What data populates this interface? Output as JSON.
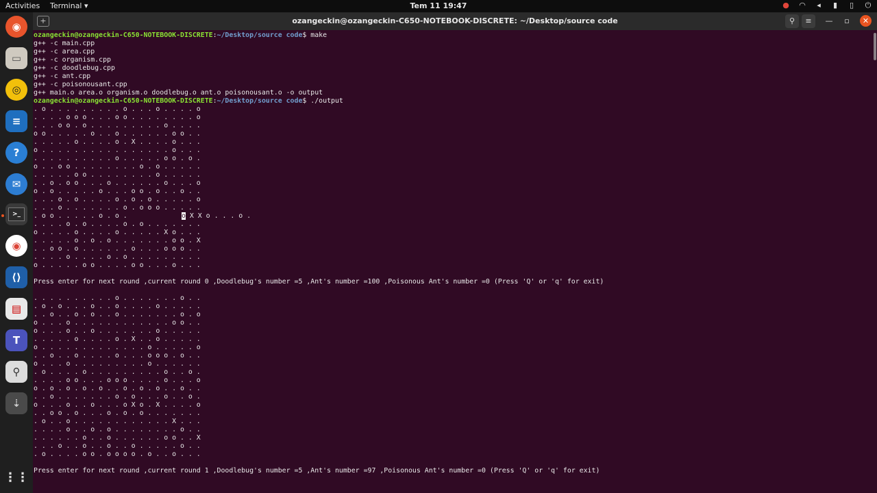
{
  "topbar": {
    "activities": "Activities",
    "app_menu": "Terminal ▾",
    "clock": "Tem 11  19:47"
  },
  "tray_icons": [
    "screen-record-icon",
    "wifi-icon",
    "volume-icon",
    "microphone-icon",
    "battery-icon",
    "power-icon"
  ],
  "dock": {
    "items": [
      "firefox-icon",
      "files-icon",
      "rhythmbox-icon",
      "libreoffice-writer-icon",
      "help-icon",
      "thunderbird-icon",
      "terminal-icon",
      "chrome-icon",
      "vscode-icon",
      "document-viewer-icon",
      "teams-icon",
      "image-viewer-icon",
      "usb-drive-icon",
      "show-applications-icon"
    ]
  },
  "terminal": {
    "title": "ozangeckin@ozangeckin-C650-NOTEBOOK-DISCRETE: ~/Desktop/source code",
    "prompt": {
      "user_host": "ozangeckin@ozangeckin-C650-NOTEBOOK-DISCRETE",
      "path": "~/Desktop/source code",
      "cmd1": "$ make",
      "cmd2": "$ ./output"
    },
    "build_lines": [
      "g++ -c main.cpp",
      "g++ -c area.cpp",
      "g++ -c organism.cpp",
      "g++ -c doodlebug.cpp",
      "g++ -c ant.cpp",
      "g++ -c poisonousant.cpp",
      "g++ main.o area.o organism.o doodlebug.o ant.o poisonousant.o -o output"
    ],
    "grid1": [
      ". o . . . . . . . . . o . . . o . . . . o",
      ". . . . o o o . . . o o . . . . . . . . o",
      ". . . o o . o . . . . . . . . . o . . . .",
      "o o . . . . . o . . o . . . . . . o o . .",
      ". . . . . o . . . . o . X . . . . o . . .",
      "o . . . . . . . . . . . . . . . . o . . .",
      ". . . . . . . . . . o . . . . . o o . o .",
      "o . . o o . . . . . . . . o . o . . . . .",
      ". . . . . o o . . . . . . . . o . . . . .",
      ". . o . o o . . . o . . . . . . o . . . o",
      "o . o . . . . . o . . . o o . o . . o . .",
      ". . . o . o . . . . o . o . o . . . . . o",
      ". . . o . . . . . . . o . o o o . . . . .",
      ". o o . . . . . o . o . ",
      ". . . . o . o . . . . o . o . . . . . . .",
      "o . . . . o . . . . o . . . . . X o . . .",
      ". . . . . o . o . o . . . . . . . o o . X",
      ". . o o . o . . . . . . o . . . o o o . .",
      ". . . . o . . . . o . o . . . . . . . . .",
      "o . . . . . o o . . . . o o . . . o . . ."
    ],
    "grid1_row13_highlight": "o",
    "grid1_row13_rest": " X X o . . . o .",
    "status1": "Press enter for next round ,current round 0 ,Doodlebug's number =5 ,Ant's number =100 ,Poisonous Ant's number =0 (Press 'Q' or 'q' for exit)",
    "grid2": [
      ". . . . . . . . . . o . . . . . . . o . .",
      ". o . o . . . o . . o . . . . o . . . . .",
      ". . o . . o . o . . o . . . . . . . o . o",
      "o . . . o . . . . . . . . . . . . o o . .",
      "o . . . o . . o . . . . . . . o . . . . .",
      ". . . . . o . . . . o . X . . o . . . . .",
      "o . . . . . . . . . . . . . o . . . . . o",
      ". . o . . o . . . . o . . . o o o . o . .",
      "o . . . o . . . . . . . . . o . . . . . .",
      ". o . . . . o . . . . . . . . . o . . o .",
      ". . . . o o . . . o o o . . . . o . . . o",
      "o . o . o . o . o . . o . o . o . . o . .",
      ". . o . . . . . . . o . o . . . o . . o .",
      "o . . . o . . o . . . o X o . X . . . . o",
      ". . o o . o . . . o . o . o . . . . . . .",
      ". o . . o . . . . . . . . . . . . X . . .",
      ". . . . o . . o . o . . . . . . . . o . .",
      ". . . . . . o . . o . . . . . . o o . . X",
      ". . . o . . o . . o . . o . . . . . o . .",
      ". o . . . . o o . o o o o . o . . o . . ."
    ],
    "status2": "Press enter for next round ,current round 1 ,Doodlebug's number =5 ,Ant's number =97 ,Poisonous Ant's number =0 (Press 'Q' or 'q' for exit)"
  }
}
